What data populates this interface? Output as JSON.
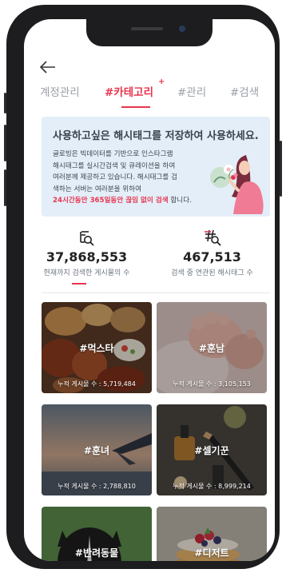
{
  "header": {
    "back_icon": "arrow-left-icon"
  },
  "tabs": [
    {
      "label": "계정관리",
      "active": false
    },
    {
      "label": "#카테고리",
      "active": true,
      "badge": "+"
    },
    {
      "label": "#관리",
      "active": false
    },
    {
      "label": "#검색",
      "active": false
    }
  ],
  "info": {
    "title": "사용하고싶은 해시태그를 저장하여 사용하세요.",
    "lines": [
      "글로빙은 빅데이터를 기반으로 인스타그램",
      "해시태그를 실시간검색 및 큐레이션을 하여",
      "여러분께 제공하고 있습니다. 해시태그를 검",
      "색하는 서버는 여러분을 위하여"
    ],
    "highlight": "24시간동안 365일동안 끊임 없이 검색",
    "highlight_suffix": " 합니다.",
    "illustration": "woman-smelling-flower-illustration"
  },
  "stats": [
    {
      "icon": "search-list-icon",
      "value": "37,868,553",
      "label": "현재까지 검색한 게시물의 수"
    },
    {
      "icon": "hashtag-search-icon",
      "value": "467,513",
      "label": "검색 중 연관된 해시태그 수"
    }
  ],
  "categories": [
    {
      "tag": "#먹스타",
      "count": "누적 게시물 수 : 5,719,484",
      "image": "grilled-food-platter"
    },
    {
      "tag": "#훈남",
      "count": "누적 게시물 수 : 3,105,153",
      "image": "baby-feet"
    },
    {
      "tag": "#훈녀",
      "count": "누적 게시물 수 : 2,788,810",
      "image": "airplane-wing-sunset"
    },
    {
      "tag": "#셀기꾼",
      "count": "누적 게시물 수 : 8,999,214",
      "image": "cosmetics-serum-brush"
    },
    {
      "tag": "#반려동물",
      "count": "",
      "image": "border-collie-dog"
    },
    {
      "tag": "#디저트",
      "count": "",
      "image": "pancake-stack-berries"
    }
  ],
  "colors": {
    "accent": "#e8344e",
    "info_bg": "#e3eef8",
    "muted": "#9aa0a8"
  }
}
